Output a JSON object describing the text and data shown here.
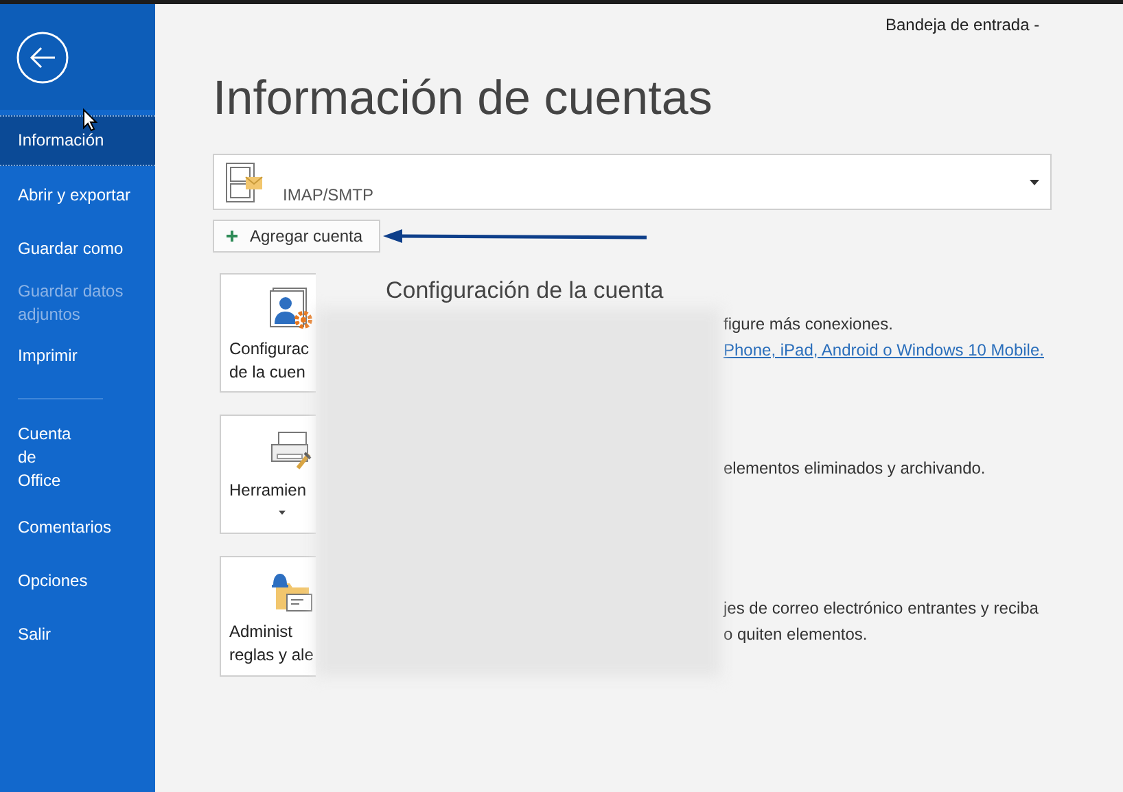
{
  "window": {
    "title": "Bandeja de entrada -"
  },
  "sidebar": {
    "items": [
      {
        "label": "Información",
        "selected": true,
        "disabled": false
      },
      {
        "label": "Abrir y exportar",
        "selected": false,
        "disabled": false
      },
      {
        "label": "Guardar como",
        "selected": false,
        "disabled": false
      },
      {
        "label": "Guardar datos adjuntos",
        "selected": false,
        "disabled": true
      },
      {
        "label": "Imprimir",
        "selected": false,
        "disabled": false
      }
    ],
    "account_items": [
      {
        "label": "Cuenta de Office",
        "selected": false,
        "disabled": false
      },
      {
        "label": "Comentarios",
        "selected": false,
        "disabled": false
      },
      {
        "label": "Opciones",
        "selected": false,
        "disabled": false
      },
      {
        "label": "Salir",
        "selected": false,
        "disabled": false
      }
    ]
  },
  "page_title": "Información de cuentas",
  "account": {
    "type": "IMAP/SMTP"
  },
  "add_account_button": "Agregar cuenta",
  "section_heading": "Configuración de la cuenta",
  "sections": [
    {
      "kind": "account",
      "dropdown": false,
      "label_lines": [
        "Configurac",
        "de la cuen"
      ],
      "lines": [
        {
          "kind": "text",
          "text": "figure más conexiones."
        },
        {
          "kind": "link",
          "text": "Phone, iPad, Android o Windows 10 Mobile."
        }
      ]
    },
    {
      "kind": "tools",
      "dropdown": true,
      "label_lines": [
        "Herramien"
      ],
      "lines": [
        {
          "kind": "text",
          "text": "elementos eliminados y archivando."
        }
      ]
    },
    {
      "kind": "rules",
      "dropdown": false,
      "label_lines": [
        "Administ",
        "reglas y ale"
      ],
      "lines": [
        {
          "kind": "text",
          "text": "jes de correo electrónico entrantes y reciba"
        },
        {
          "kind": "text",
          "text": "o quiten elementos."
        }
      ]
    }
  ]
}
